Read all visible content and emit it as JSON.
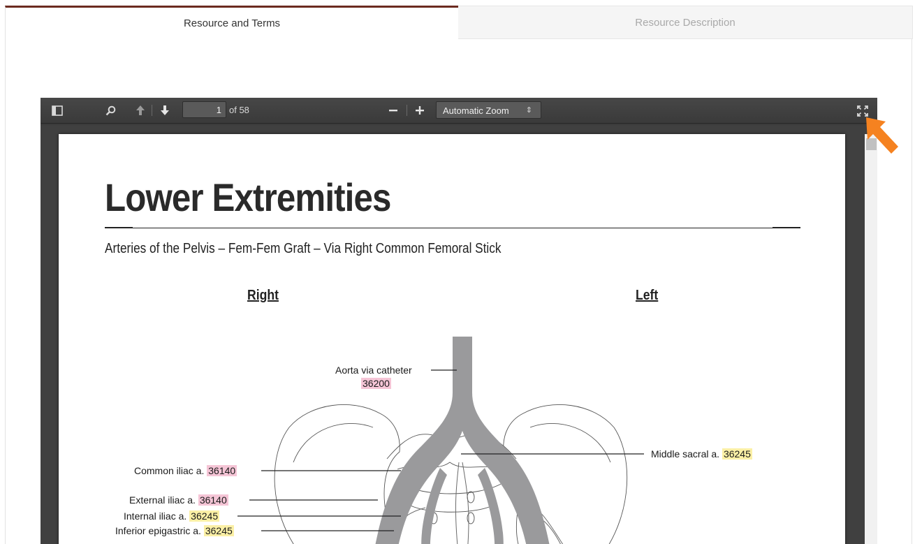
{
  "tabs": [
    {
      "label": "Resource and Terms",
      "active": true
    },
    {
      "label": "Resource Description",
      "active": false
    }
  ],
  "toolbar": {
    "page_number": "1",
    "page_count": "of 58",
    "zoom": "Automatic Zoom"
  },
  "document": {
    "title": "Lower Extremities",
    "subtitle": "Arteries of the Pelvis – Fem-Fem Graft – Via Right Common Femoral Stick",
    "side_right": "Right",
    "side_left": "Left",
    "labels": [
      {
        "text": "Aorta via catheter",
        "code": "36200",
        "code_color": "pink"
      },
      {
        "text": "Middle sacral a.",
        "code": "36245",
        "code_color": "yellow"
      },
      {
        "text": "Common iliac a.",
        "code": "36140",
        "code_color": "pink"
      },
      {
        "text": "External iliac a.",
        "code": "36140",
        "code_color": "pink"
      },
      {
        "text": "Internal iliac a.",
        "code": "36245",
        "code_color": "yellow"
      },
      {
        "text": "Inferior epigastric a.",
        "code": "36245",
        "code_color": "yellow"
      }
    ]
  },
  "colors": {
    "tab_accent": "#6b2a1f",
    "code_pink": "#f5c5d6",
    "code_yellow": "#fbf0a6",
    "annotation_arrow": "#f58220"
  },
  "icons": [
    "sidebar-toggle-icon",
    "search-icon",
    "arrow-up-icon",
    "arrow-down-icon",
    "minus-icon",
    "plus-icon",
    "fullscreen-icon"
  ]
}
